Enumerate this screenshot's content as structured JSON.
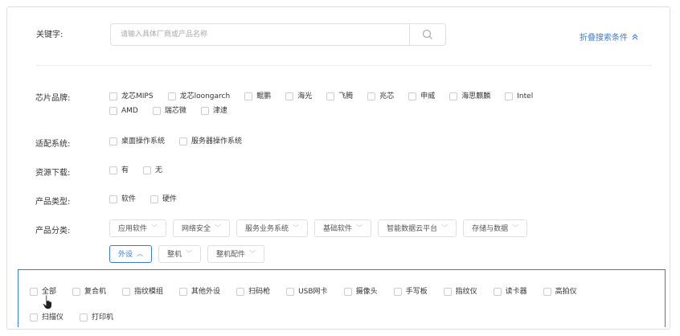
{
  "keyword": {
    "label": "关键字:",
    "placeholder": "请输入具体厂商或产品名称",
    "value": ""
  },
  "collapse_label": "折叠搜索条件",
  "filters": {
    "chip_brand": {
      "label": "芯片品牌:",
      "row1": [
        "龙芯MIPS",
        "龙芯loongarch",
        "鲲鹏",
        "海光",
        "飞腾",
        "兆芯",
        "申威",
        "海思麒麟",
        "Intel"
      ],
      "row2": [
        "AMD",
        "瑞芯微",
        "津逮"
      ]
    },
    "os": {
      "label": "适配系统:",
      "options": [
        "桌面操作系统",
        "服务器操作系统"
      ]
    },
    "download": {
      "label": "资源下载:",
      "options": [
        "有",
        "无"
      ]
    },
    "product_type": {
      "label": "产品类型:",
      "options": [
        "软件",
        "硬件"
      ]
    },
    "category": {
      "label": "产品分类:",
      "row1": [
        "应用软件",
        "网络安全",
        "服务业务系统",
        "基础软件",
        "智能数据云平台",
        "存储与数据"
      ],
      "row2": [
        "外设",
        "整机",
        "整机配件"
      ],
      "active": "外设"
    }
  },
  "peripherals": {
    "row1": [
      "全部",
      "复合机",
      "指纹模组",
      "其他外设",
      "扫码枪",
      "USB网卡",
      "摄像头",
      "手写板",
      "指纹仪",
      "读卡器",
      "高拍仪"
    ],
    "row2": [
      "扫描仪",
      "打印机"
    ]
  },
  "colors": {
    "accent": "#3a7bd5",
    "border": "#dcdfe6"
  }
}
